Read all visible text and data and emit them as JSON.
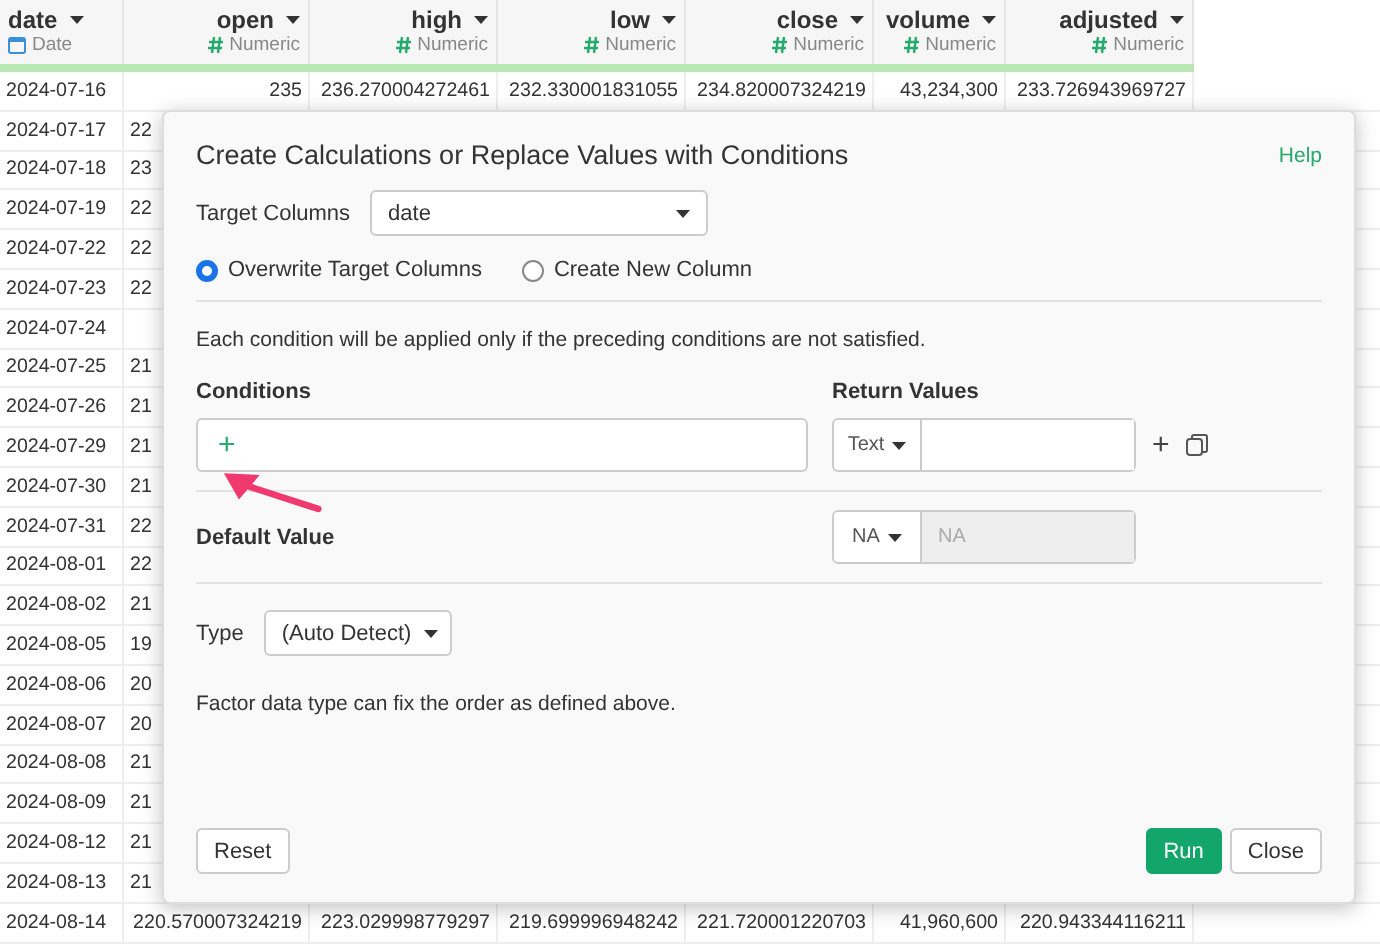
{
  "table": {
    "columns": [
      {
        "name": "date",
        "type": "Date",
        "kind": "date"
      },
      {
        "name": "open",
        "type": "Numeric",
        "kind": "numeric"
      },
      {
        "name": "high",
        "type": "Numeric",
        "kind": "numeric"
      },
      {
        "name": "low",
        "type": "Numeric",
        "kind": "numeric"
      },
      {
        "name": "close",
        "type": "Numeric",
        "kind": "numeric"
      },
      {
        "name": "volume",
        "type": "Numeric",
        "kind": "numeric"
      },
      {
        "name": "adjusted",
        "type": "Numeric",
        "kind": "numeric"
      }
    ],
    "rows": [
      [
        "2024-07-16",
        "235",
        "236.270004272461",
        "232.330001831055",
        "234.820007324219",
        "43,234,300",
        "233.726943969727"
      ],
      [
        "2024-07-17",
        "22"
      ],
      [
        "2024-07-18",
        "23"
      ],
      [
        "2024-07-19",
        "22"
      ],
      [
        "2024-07-22",
        "22"
      ],
      [
        "2024-07-23",
        "22"
      ],
      [
        "2024-07-24"
      ],
      [
        "2024-07-25",
        "21"
      ],
      [
        "2024-07-26",
        "21"
      ],
      [
        "2024-07-29",
        "21"
      ],
      [
        "2024-07-30",
        "21"
      ],
      [
        "2024-07-31",
        "22"
      ],
      [
        "2024-08-01",
        "22"
      ],
      [
        "2024-08-02",
        "21"
      ],
      [
        "2024-08-05",
        "19"
      ],
      [
        "2024-08-06",
        "20"
      ],
      [
        "2024-08-07",
        "20"
      ],
      [
        "2024-08-08",
        "21"
      ],
      [
        "2024-08-09",
        "21"
      ],
      [
        "2024-08-12",
        "21"
      ],
      [
        "2024-08-13",
        "21"
      ],
      [
        "2024-08-14",
        "220.570007324219",
        "223.029998779297",
        "219.699996948242",
        "221.720001220703",
        "41,960,600",
        "220.943344116211"
      ]
    ]
  },
  "dialog": {
    "title": "Create Calculations or Replace Values with Conditions",
    "help": "Help",
    "target_label": "Target Columns",
    "target_value": "date",
    "modes": [
      {
        "label": "Overwrite Target Columns",
        "selected": true
      },
      {
        "label": "Create New Column",
        "selected": false
      }
    ],
    "note": "Each condition will be applied only if the preceding conditions are not satisfied.",
    "conditions_label": "Conditions",
    "add_condition": "+",
    "return_label": "Return Values",
    "return_type": "Text",
    "add_return": "+",
    "default_label": "Default Value",
    "default_type": "NA",
    "default_placeholder": "NA",
    "type_label": "Type",
    "type_value": "(Auto Detect)",
    "factor_note": "Factor data type can fix the order as defined above.",
    "buttons": {
      "reset": "Reset",
      "run": "Run",
      "close": "Close"
    }
  }
}
